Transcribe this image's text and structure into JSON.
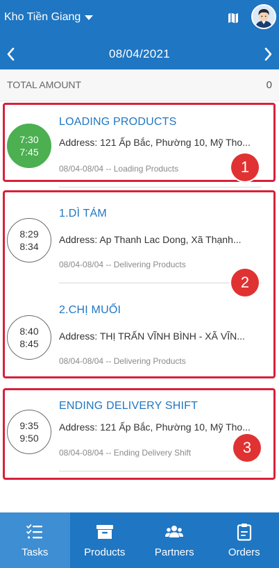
{
  "header": {
    "warehouse": "Kho Tiền Giang",
    "date": "08/04/2021"
  },
  "summary": {
    "total_label": "TOTAL AMOUNT",
    "total_value": "0"
  },
  "tasks": [
    {
      "start": "7:30",
      "end": "7:45",
      "title": "LOADING PRODUCTS",
      "address": "Address: 121 Ấp Bắc, Phường 10, Mỹ Tho...",
      "meta": "08/04-08/04 -- Loading Products",
      "status": "done"
    },
    {
      "start": "8:29",
      "end": "8:34",
      "title": "1.DÌ TÁM",
      "address": "Address: Ap Thanh Lac Dong, Xã Thạnh...",
      "meta": "08/04-08/04 -- Delivering Products",
      "status": "pending"
    },
    {
      "start": "8:40",
      "end": "8:45",
      "title": "2.CHỊ  MUỐI",
      "address": "Address: THỊ TRẤN VĨNH BÌNH - XÃ VĨN...",
      "meta": "08/04-08/04 -- Delivering Products",
      "status": "pending"
    },
    {
      "start": "9:35",
      "end": "9:50",
      "title": "ENDING DELIVERY SHIFT",
      "address": "Address: 121 Ấp Bắc, Phường 10, Mỹ Tho...",
      "meta": "08/04-08/04 -- Ending Delivery Shift",
      "status": "pending"
    }
  ],
  "annotations": [
    "1",
    "2",
    "3"
  ],
  "bottom_nav": [
    {
      "label": "Tasks",
      "icon": "tasks-icon",
      "active": true
    },
    {
      "label": "Products",
      "icon": "archive-box-icon",
      "active": false
    },
    {
      "label": "Partners",
      "icon": "users-icon",
      "active": false
    },
    {
      "label": "Orders",
      "icon": "clipboard-icon",
      "active": false
    }
  ],
  "colors": {
    "primary": "#1f76c2",
    "active_tab": "#3e8ed3",
    "done_green": "#4caf50",
    "annotation_red": "#d8203a"
  }
}
